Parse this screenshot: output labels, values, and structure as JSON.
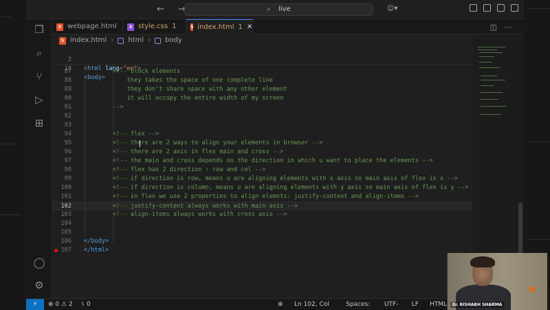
{
  "titlebar": {
    "nav_back_forward": "←  →",
    "search_text": "live"
  },
  "tabs": [
    {
      "label": "webpage.html",
      "icon": "html5-icon",
      "badge": ""
    },
    {
      "label": "style.css",
      "icon": "css3-icon",
      "badge": "1"
    },
    {
      "label": "index.html",
      "icon": "html5-icon",
      "badge": "1",
      "active": true
    }
  ],
  "breadcrumb": {
    "file": "index.html",
    "items": [
      "html",
      "body"
    ]
  },
  "sticky_lines": [
    {
      "num": "2",
      "open": "<",
      "tag": "html",
      "attr": "lang",
      "eq": "=",
      "value": "\"en\"",
      "close": ">"
    },
    {
      "num": "18",
      "open": "<",
      "tag": "body",
      "close": ">"
    }
  ],
  "code_lines": [
    {
      "num": "87",
      "text": "<!-- block elements"
    },
    {
      "num": "88",
      "text": "    they takes the space of one complete line"
    },
    {
      "num": "89",
      "text": "    they don't share space with any other element"
    },
    {
      "num": "90",
      "text": "    it will occupy the entire width of my screen"
    },
    {
      "num": "91",
      "text": "-->"
    },
    {
      "num": "92",
      "text": ""
    },
    {
      "num": "93",
      "text": ""
    },
    {
      "num": "94",
      "text": "<!-- flex -->"
    },
    {
      "num": "95",
      "text": "<!-- there are 2 ways to align your elements in browser -->"
    },
    {
      "num": "96",
      "text": "<!-- there are 2 axis in flex main and cross -->"
    },
    {
      "num": "97",
      "text": "<!-- the main and cross depends on the direction in which u want to place the elements -->"
    },
    {
      "num": "98",
      "text": "<!-- flex has 2 direction : row and col -->"
    },
    {
      "num": "99",
      "text": "<!-- if direction is row, means u are aligning elements with x axis so main axis of flex is x -->"
    },
    {
      "num": "100",
      "text": "<!-- if direction is column, means u are aligning elements with y axis so main axis of flex is y -->"
    },
    {
      "num": "101",
      "text": "<!-- in flex we use 2 properties to align elemnts: justify-content and align-items -->"
    },
    {
      "num": "102",
      "text": "<!-- justify-content always works with main axis -->",
      "current": true
    },
    {
      "num": "103",
      "text": "<!-- align-items always works with cross axis -->"
    },
    {
      "num": "104",
      "text": ""
    },
    {
      "num": "105",
      "text": ""
    },
    {
      "num": "106",
      "text": "</body>",
      "tag": true
    },
    {
      "num": "107",
      "text": "</html>",
      "tag": true,
      "error": true
    }
  ],
  "statusbar": {
    "remote": "⚡",
    "errors": "0",
    "warnings": "2",
    "ports": "0",
    "position": "Ln 102, Col 58",
    "spaces": "Spaces: 4",
    "encoding": "UTF-8",
    "eol": "LF",
    "language": "HTML"
  },
  "webcam": {
    "name": "Er. RISHABH SHARMA"
  },
  "colors": {
    "comment": "#6a9955",
    "accent": "#0e70c0",
    "error": "#e51400"
  }
}
